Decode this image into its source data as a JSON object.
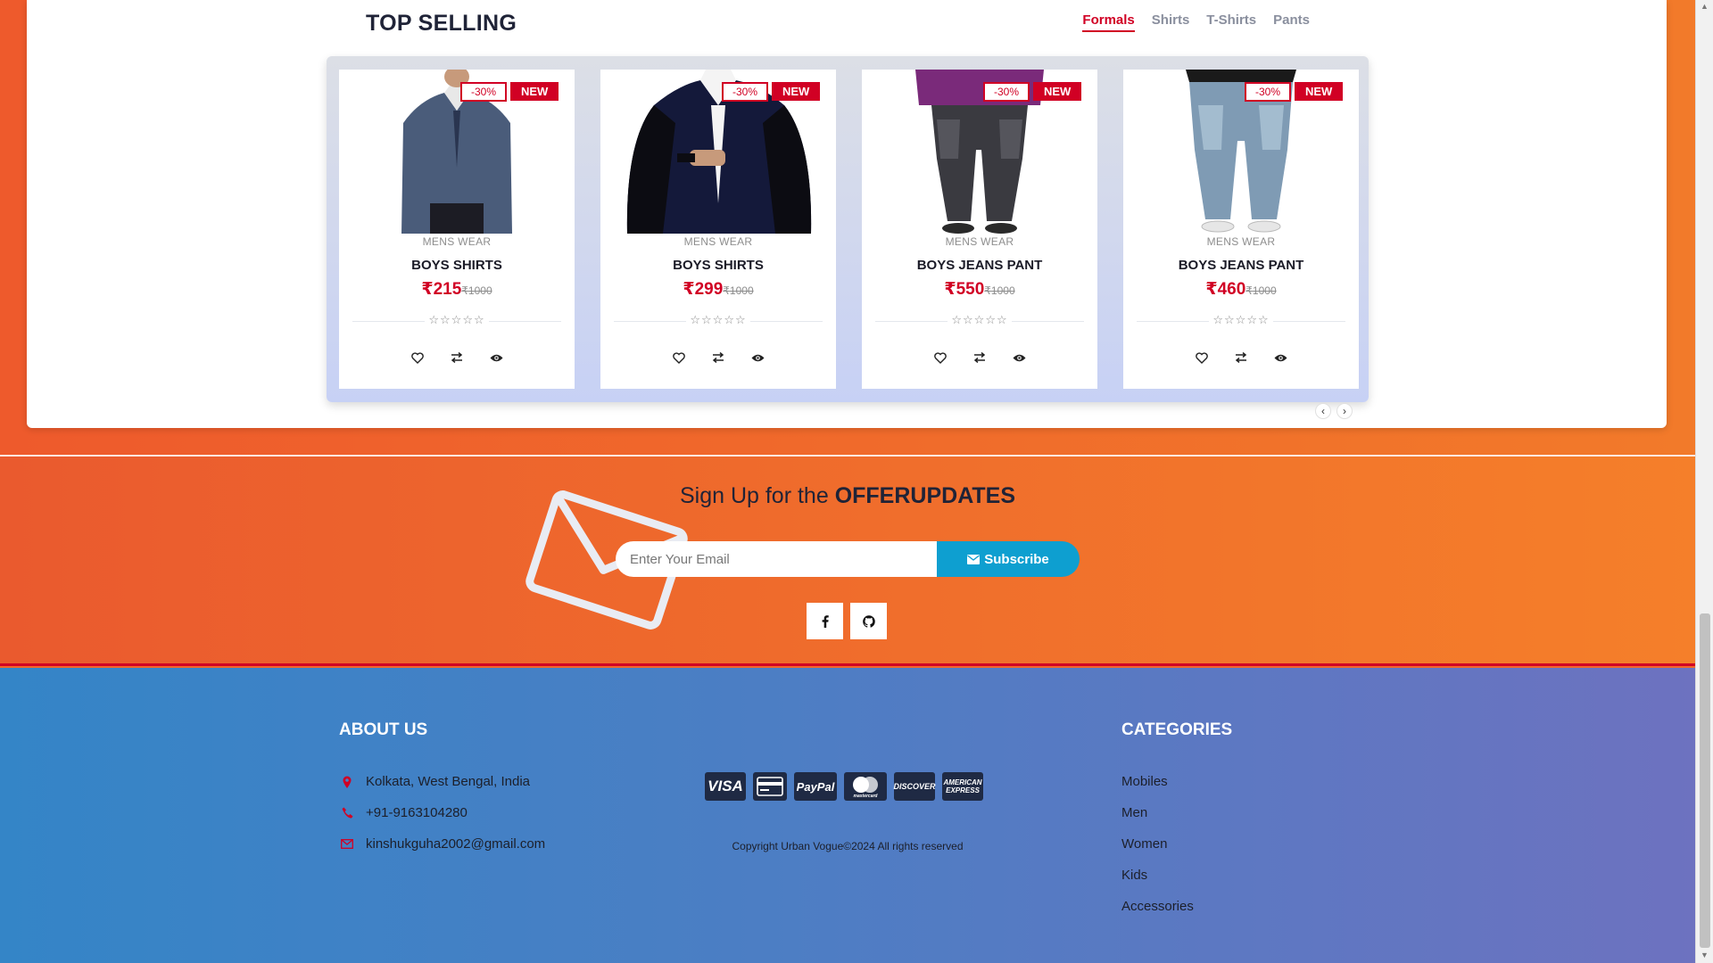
{
  "top_selling": {
    "title": "TOP SELLING",
    "tabs": [
      {
        "label": "Formals",
        "active": true
      },
      {
        "label": "Shirts",
        "active": false
      },
      {
        "label": "T-Shirts",
        "active": false
      },
      {
        "label": "Pants",
        "active": false
      }
    ],
    "products": [
      {
        "sale": "-30%",
        "badge": "NEW",
        "category": "MENS WEAR",
        "name": "BOYS SHIRTS",
        "price": "₹215",
        "old_price": "₹1000",
        "image": "grey-blazer"
      },
      {
        "sale": "-30%",
        "badge": "NEW",
        "category": "MENS WEAR",
        "name": "BOYS SHIRTS",
        "price": "₹299",
        "old_price": "₹1000",
        "image": "navy-blazer"
      },
      {
        "sale": "-30%",
        "badge": "NEW",
        "category": "MENS WEAR",
        "name": "BOYS JEANS PANT",
        "price": "₹550",
        "old_price": "₹1000",
        "image": "black-jeans"
      },
      {
        "sale": "-30%",
        "badge": "NEW",
        "category": "MENS WEAR",
        "name": "BOYS JEANS PANT",
        "price": "₹460",
        "old_price": "₹1000",
        "image": "blue-jeans"
      }
    ],
    "stars": "☆☆☆☆☆",
    "nav_prev": "‹",
    "nav_next": "›"
  },
  "newsletter": {
    "title_prefix": "Sign Up for the ",
    "title_bold": "OFFERUPDATES",
    "email_placeholder": "Enter Your Email",
    "subscribe_label": "Subscribe"
  },
  "footer": {
    "about_title": "ABOUT US",
    "address": "Kolkata, West Bengal, India",
    "phone": "+91-9163104280",
    "email": "kinshukguha2002@gmail.com",
    "payments": [
      "VISA",
      "card",
      "PayPal",
      "mastercard",
      "DISCOVER",
      "AMERICAN EXPRESS"
    ],
    "copyright": "Copyright Urban Vogue©2024 All rights reserved",
    "categories_title": "CATEGORIES",
    "categories": [
      "Mobiles",
      "Men",
      "Women",
      "Kids",
      "Accessories"
    ]
  },
  "colors": {
    "accent": "#d10024",
    "subscribe": "#0e9fd0",
    "orange": "#f27a2a",
    "footer_blue": "#3485c7"
  }
}
